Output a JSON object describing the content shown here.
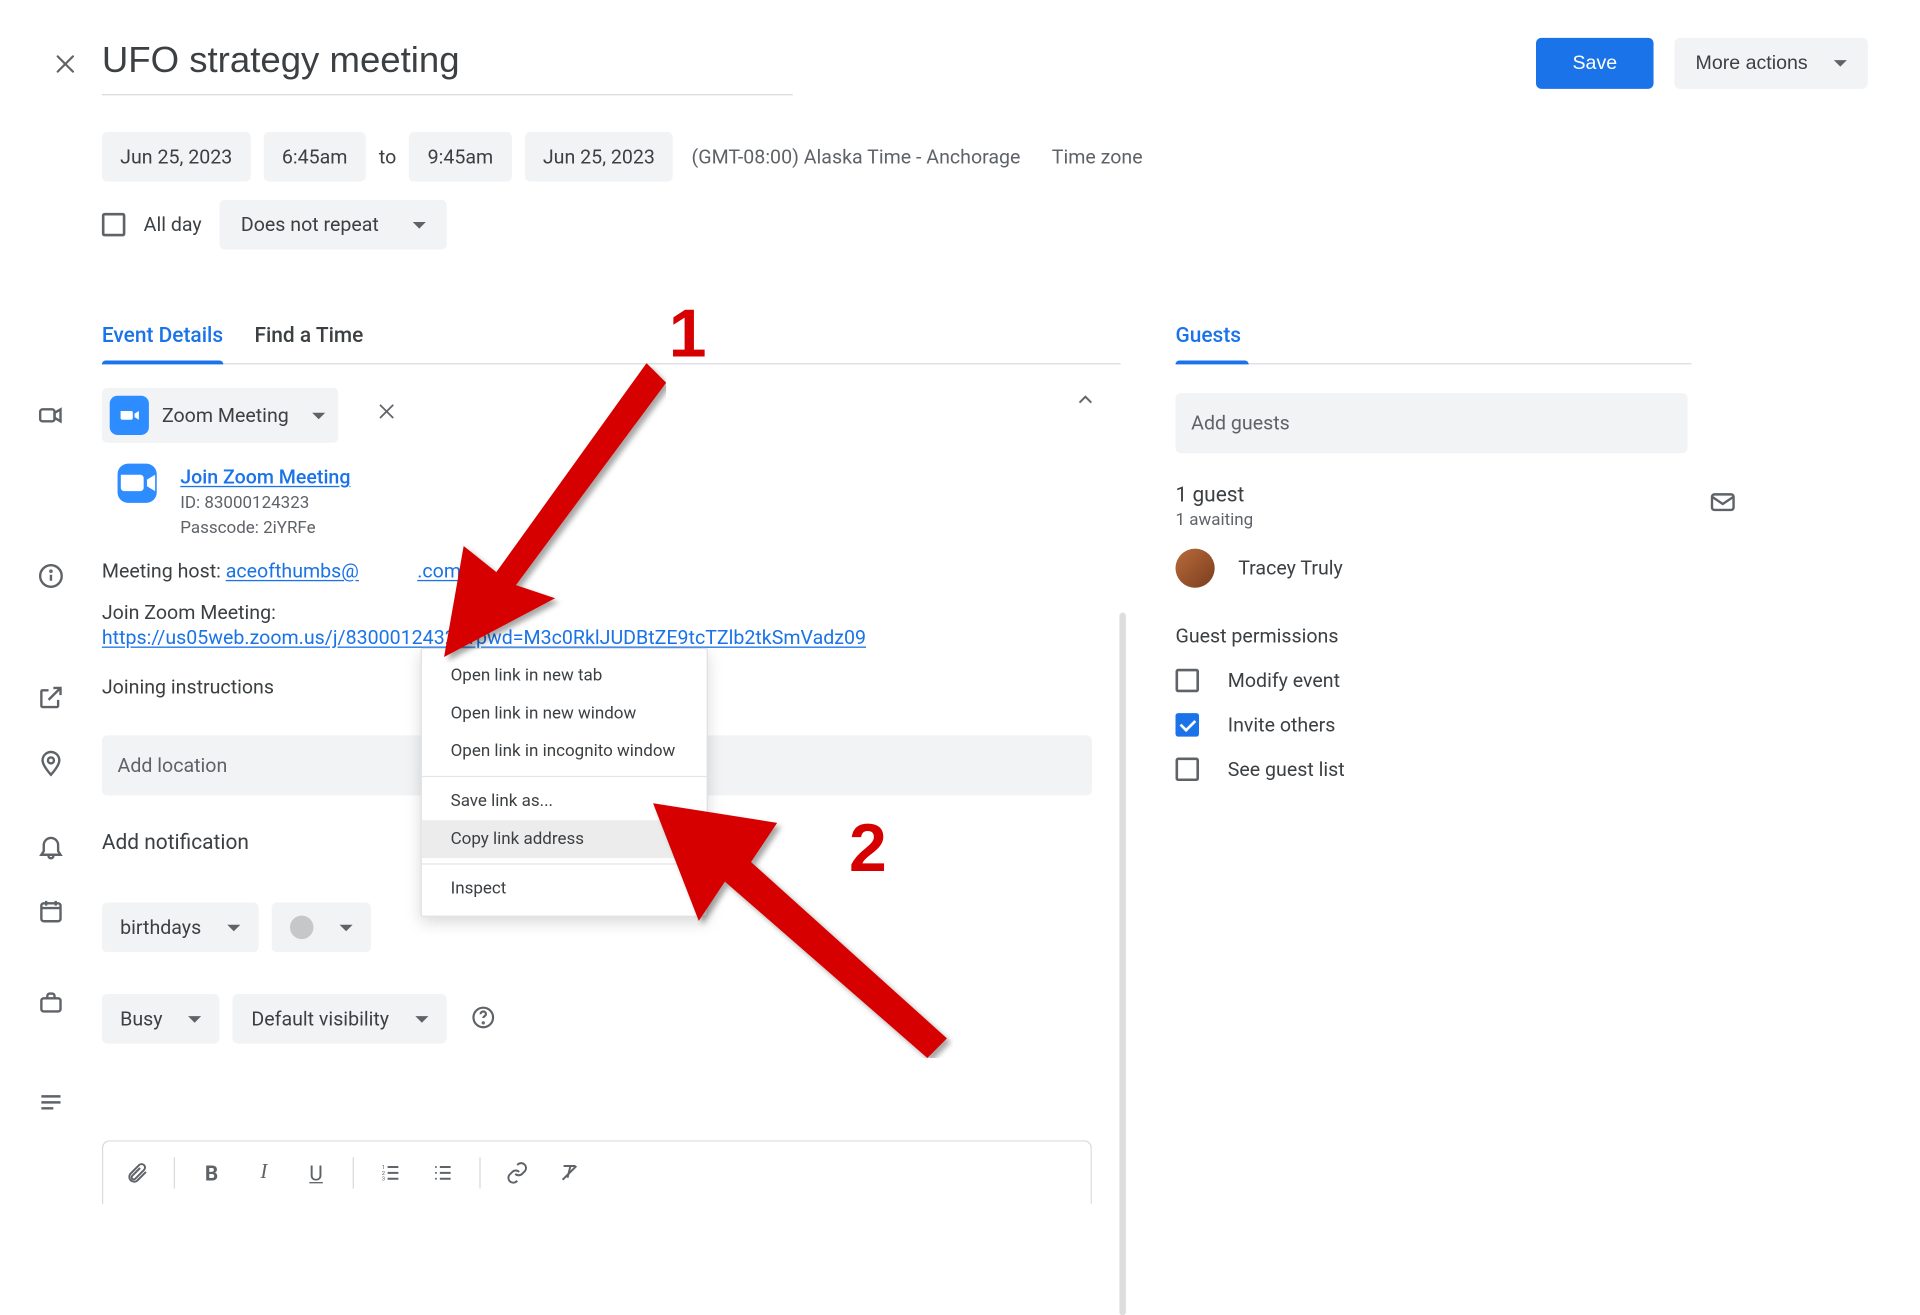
{
  "header": {
    "title": "UFO strategy meeting",
    "save": "Save",
    "more_actions": "More actions"
  },
  "datetime": {
    "start_date": "Jun 25, 2023",
    "start_time": "6:45am",
    "to": "to",
    "end_time": "9:45am",
    "end_date": "Jun 25, 2023",
    "timezone": "(GMT-08:00) Alaska Time - Anchorage",
    "timezone_link": "Time zone"
  },
  "allday": {
    "label": "All day",
    "repeat": "Does not repeat"
  },
  "tabs": {
    "details": "Event Details",
    "find_time": "Find a Time"
  },
  "conferencing": {
    "provider": "Zoom Meeting",
    "join_title": "Join Zoom Meeting",
    "id_label": "ID: 83000124323",
    "passcode_label": "Passcode: 2iYRFe",
    "host_label": "Meeting host: ",
    "host_email": "aceofthumbs@",
    "host_email_tail": ".com",
    "join_text": "Join Zoom Meeting:",
    "join_url": "https://us05web.zoom.us/j/83000124323?pwd=M3c0RklJUDBtZE9tcTZlb2tkSmVadz09",
    "joining_instructions": "Joining instructions"
  },
  "location": {
    "placeholder": "Add location"
  },
  "notification": {
    "label": "Add notification"
  },
  "calendar_row": {
    "calendar": "birthdays"
  },
  "availability": {
    "busy": "Busy",
    "visibility": "Default visibility"
  },
  "guests": {
    "header": "Guests",
    "add_placeholder": "Add guests",
    "count": "1 guest",
    "awaiting": "1 awaiting",
    "list": [
      {
        "name": "Tracey Truly"
      }
    ],
    "permissions_title": "Guest permissions",
    "perm_modify": "Modify event",
    "perm_invite": "Invite others",
    "perm_seelist": "See guest list"
  },
  "context_menu": {
    "items": [
      "Open link in new tab",
      "Open link in new window",
      "Open link in incognito window",
      "Save link as...",
      "Copy link address",
      "Inspect"
    ]
  },
  "annotations": {
    "one": "1",
    "two": "2"
  }
}
